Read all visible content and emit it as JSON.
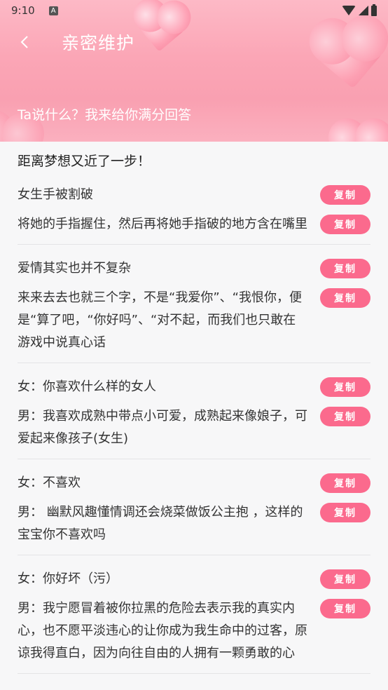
{
  "status": {
    "time": "9:10",
    "notification_glyph": "A"
  },
  "header": {
    "title": "亲密维护",
    "subtitle": "Ta说什么？我来给你满分回答"
  },
  "intro": "距离梦想又近了一步！",
  "copy_label": "复制",
  "groups": [
    {
      "lines": [
        "女生手被割破",
        "将她的手指握住，然后再将她手指破的地方含在嘴里"
      ]
    },
    {
      "lines": [
        "爱情其实也并不复杂",
        "来来去去也就三个字，不是“我爱你”、“我恨你，便是“算了吧，“你好吗”、“对不起，而我们也只敢在游戏中说真心话"
      ]
    },
    {
      "lines": [
        "女：你喜欢什么样的女人",
        "男：我喜欢成熟中带点小可爱，成熟起来像娘子，可爱起来像孩子(女生)"
      ]
    },
    {
      "lines": [
        "女：不喜欢",
        "男： 幽默风趣懂情调还会烧菜做饭公主抱 ，这样的宝宝你不喜欢吗"
      ]
    },
    {
      "lines": [
        "女：你好坏（污）",
        "男：我宁愿冒着被你拉黑的危险去表示我的真实内心，也不愿平淡违心的让你成为我生命中的过客，原谅我得直白，因为向往自由的人拥有一颗勇敢的心"
      ]
    }
  ]
}
